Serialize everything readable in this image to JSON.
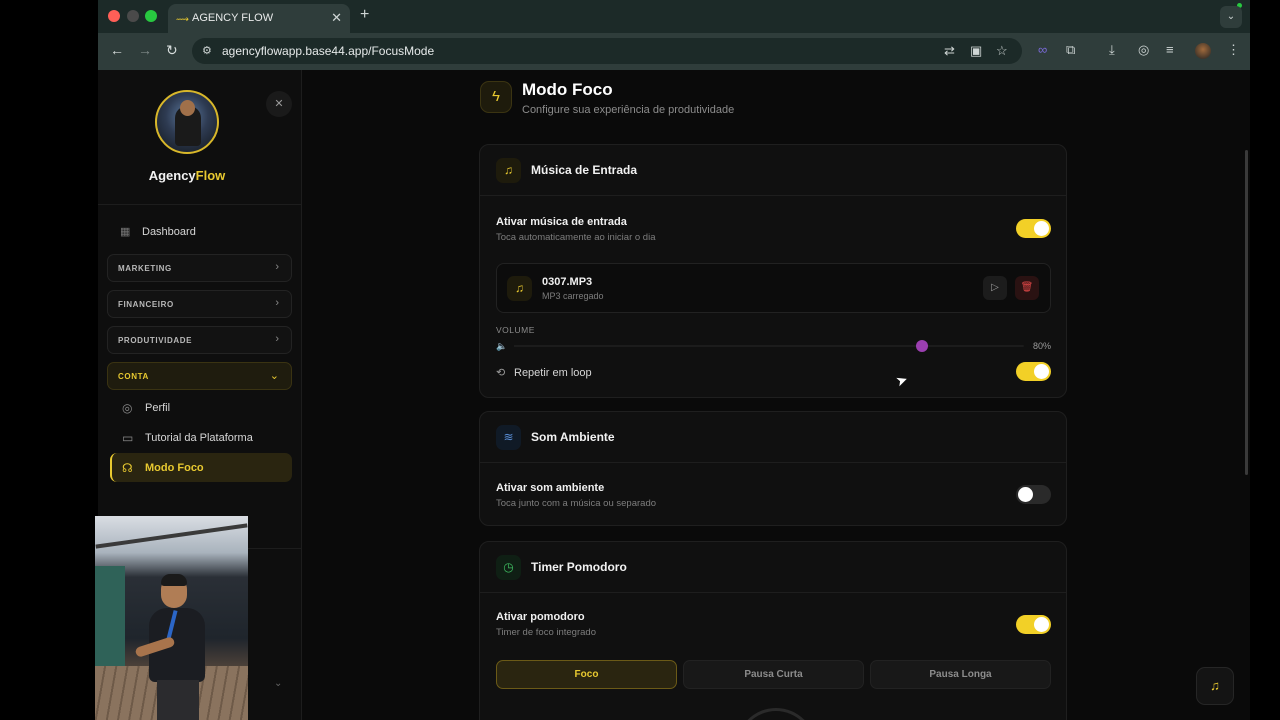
{
  "browser": {
    "tab_title": "AGENCY FLOW",
    "url": "agencyflowapp.base44.app/FocusMode"
  },
  "sidebar": {
    "brand_prefix": "Agency",
    "brand_accent": "Flow",
    "dashboard": "Dashboard",
    "groups": [
      {
        "label": "MARKETING"
      },
      {
        "label": "FINANCEIRO"
      },
      {
        "label": "PRODUTIVIDADE"
      },
      {
        "label": "CONTA"
      }
    ],
    "sub_items": [
      {
        "label": "Perfil"
      },
      {
        "label": "Tutorial da Plataforma"
      },
      {
        "label": "Modo Foco"
      }
    ]
  },
  "header": {
    "title": "Modo Foco",
    "subtitle": "Configure sua experiência de produtividade"
  },
  "music_card": {
    "title": "Música de Entrada",
    "toggle_title": "Ativar música de entrada",
    "toggle_sub": "Toca automaticamente ao iniciar o dia",
    "toggle_on": true,
    "file_name": "0307.MP3",
    "file_status": "MP3 carregado",
    "volume_label": "VOLUME",
    "volume_value": "80%",
    "volume_level": 0.8,
    "loop_label": "Repetir em loop",
    "loop_on": true
  },
  "ambient_card": {
    "title": "Som Ambiente",
    "toggle_title": "Ativar som ambiente",
    "toggle_sub": "Toca junto com a música ou separado",
    "toggle_on": false
  },
  "pomodoro_card": {
    "title": "Timer Pomodoro",
    "toggle_title": "Ativar pomodoro",
    "toggle_sub": "Timer de foco integrado",
    "toggle_on": true,
    "modes": [
      {
        "label": "Foco",
        "active": true
      },
      {
        "label": "Pausa Curta",
        "active": false
      },
      {
        "label": "Pausa Longa",
        "active": false
      }
    ]
  },
  "colors": {
    "accent": "#e8c930",
    "slider_thumb": "#9b3fb0",
    "danger": "#e04848"
  },
  "icons": {
    "header": "lightning-icon",
    "music": "music-note-icon",
    "ambient": "wind-icon",
    "pomodoro": "timer-icon",
    "fab": "music-note-icon"
  }
}
